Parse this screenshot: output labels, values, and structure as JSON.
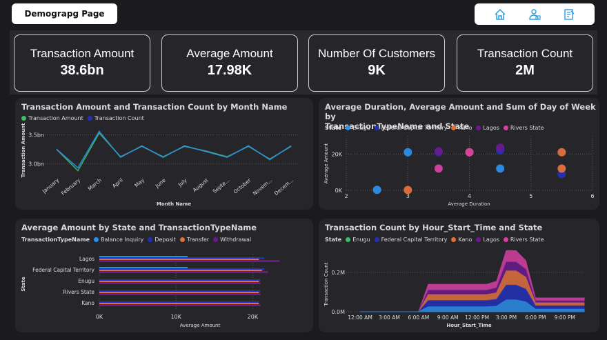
{
  "page_button": "Demograpg Page",
  "nav": {
    "icons": [
      "home-icon",
      "person-icon",
      "report-icon"
    ]
  },
  "kpis": [
    {
      "label": "Transaction Amount",
      "value": "38.6bn"
    },
    {
      "label": "Average Amount",
      "value": "17.98K"
    },
    {
      "label": "Number Of Customers",
      "value": "9K"
    },
    {
      "label": "Transaction Count",
      "value": "2M"
    }
  ],
  "colors": {
    "enugu": "#2d8ee9",
    "fct": "#2230b8",
    "kano": "#e0703e",
    "lagos": "#6b1a8e",
    "rivers": "#d640a3",
    "green": "#3cbf6a"
  },
  "chart1": {
    "title": "Transaction Amount and Transaction Count by Month Name",
    "legend": [
      "Transaction Amount",
      "Transaction Count"
    ],
    "xlabel": "Month Name",
    "ylabel": "Transaction Amount",
    "yticks": [
      "3.5bn",
      "3.0bn"
    ],
    "months": [
      "January",
      "February",
      "March",
      "April",
      "May",
      "June",
      "July",
      "August",
      "Septe...",
      "October",
      "Novem...",
      "Decem..."
    ]
  },
  "chart2": {
    "title_line1": "Average Duration, Average Amount and Sum of Day of Week by",
    "title_line2": "TransactionTypeName and State",
    "legend_title": "State",
    "legend": [
      "Enugu",
      "Federal Capital Territory",
      "Kano",
      "Lagos",
      "Rivers State"
    ],
    "xlabel": "Average Duration",
    "ylabel": "Average Amount",
    "xticks": [
      "2",
      "3",
      "4",
      "5",
      "6"
    ],
    "yticks": [
      "20K",
      "0K"
    ]
  },
  "chart3": {
    "title": "Average Amount by State and TransactionTypeName",
    "legend_title": "TransactionTypeName",
    "legend": [
      "Balance Inquiry",
      "Deposit",
      "Transfer",
      "Withdrawal"
    ],
    "ylabel": "State",
    "xlabel": "Average Amount",
    "states": [
      "Lagos",
      "Federal Capital Territory",
      "Enugu",
      "Rivers State",
      "Kano"
    ],
    "xticks": [
      "0K",
      "10K",
      "20K"
    ]
  },
  "chart4": {
    "title": "Transaction Count by Hour_Start_Time and State",
    "legend_title": "State",
    "legend": [
      "Enugu",
      "Federal Capital Territory",
      "Kano",
      "Lagos",
      "Rivers State"
    ],
    "xlabel": "Hour_Start_Time",
    "ylabel": "Transaction Count",
    "xticks": [
      "12:00 AM",
      "3:00 AM",
      "6:00 AM",
      "9:00 AM",
      "12:00 PM",
      "3:00 PM",
      "6:00 PM",
      "9:00 PM"
    ],
    "yticks": [
      "0.2M",
      "0.0M"
    ]
  },
  "chart_data": [
    {
      "type": "line",
      "title": "Transaction Amount and Transaction Count by Month Name",
      "categories": [
        "January",
        "February",
        "March",
        "April",
        "May",
        "June",
        "July",
        "August",
        "Septe...",
        "October",
        "Novem...",
        "Decem..."
      ],
      "series": [
        {
          "name": "Transaction Amount",
          "values": [
            3.25,
            2.88,
            3.53,
            3.12,
            3.3,
            3.12,
            3.3,
            3.22,
            3.12,
            3.3,
            3.08,
            3.3
          ]
        },
        {
          "name": "Transaction Count",
          "values": [
            3.25,
            2.93,
            3.56,
            3.11,
            3.31,
            3.11,
            3.31,
            3.21,
            3.11,
            3.31,
            3.07,
            3.31
          ]
        }
      ],
      "xlabel": "Month Name",
      "ylabel": "Transaction Amount",
      "ylim": [
        2.85,
        3.6
      ]
    },
    {
      "type": "scatter",
      "title": "Average Duration, Average Amount and Sum of Day of Week by TransactionTypeName and State",
      "xlabel": "Average Duration",
      "ylabel": "Average Amount",
      "xlim": [
        2,
        6
      ],
      "ylim": [
        0,
        30000
      ],
      "series": [
        {
          "name": "Enugu",
          "points": [
            [
              2.5,
              300
            ],
            [
              3.0,
              21000
            ],
            [
              4.5,
              12000
            ]
          ]
        },
        {
          "name": "Federal Capital Territory",
          "points": [
            [
              3.5,
              21000
            ],
            [
              4.5,
              22000
            ],
            [
              5.5,
              9000
            ]
          ]
        },
        {
          "name": "Kano",
          "points": [
            [
              3.0,
              200
            ],
            [
              4.0,
              21000
            ],
            [
              5.5,
              21000
            ],
            [
              5.5,
              12000
            ]
          ]
        },
        {
          "name": "Lagos",
          "points": [
            [
              3.5,
              21500
            ],
            [
              4.5,
              23500
            ]
          ]
        },
        {
          "name": "Rivers State",
          "points": [
            [
              3.5,
              12000
            ],
            [
              4.0,
              21000
            ]
          ]
        }
      ]
    },
    {
      "type": "bar",
      "title": "Average Amount by State and TransactionTypeName",
      "categories": [
        "Lagos",
        "Federal Capital Territory",
        "Enugu",
        "Rivers State",
        "Kano"
      ],
      "series": [
        {
          "name": "Balance Inquiry",
          "values": [
            11500,
            11500,
            0,
            0,
            0
          ]
        },
        {
          "name": "Deposit",
          "values": [
            21500,
            21500,
            21000,
            21000,
            20800
          ]
        },
        {
          "name": "Transfer",
          "values": [
            20800,
            21200,
            20800,
            20800,
            20800
          ]
        },
        {
          "name": "Withdrawal",
          "values": [
            23500,
            22000,
            21000,
            21000,
            21000
          ]
        }
      ],
      "xlabel": "Average Amount",
      "ylabel": "State",
      "xlim": [
        0,
        25000
      ]
    },
    {
      "type": "area",
      "title": "Transaction Count by Hour_Start_Time and State",
      "x": [
        0,
        3,
        6,
        7,
        8,
        9,
        10,
        11,
        12,
        13,
        14,
        15,
        16,
        17,
        18,
        19,
        20,
        21,
        22,
        23
      ],
      "series": [
        {
          "name": "Enugu",
          "values": [
            0,
            0,
            0,
            25000,
            25000,
            25000,
            25000,
            25000,
            25000,
            25000,
            28000,
            60000,
            60000,
            50000,
            13000,
            13000,
            13000,
            13000,
            13000,
            13000
          ]
        },
        {
          "name": "Federal Capital Territory",
          "values": [
            0,
            0,
            0,
            32000,
            32000,
            32000,
            32000,
            32000,
            32000,
            32000,
            35000,
            75000,
            75000,
            65000,
            17000,
            17000,
            17000,
            17000,
            17000,
            17000
          ]
        },
        {
          "name": "Kano",
          "values": [
            0,
            0,
            0,
            30000,
            30000,
            30000,
            30000,
            30000,
            30000,
            30000,
            33000,
            72000,
            72000,
            60000,
            15000,
            15000,
            15000,
            15000,
            15000,
            15000
          ]
        },
        {
          "name": "Lagos",
          "values": [
            0,
            0,
            0,
            22000,
            22000,
            22000,
            22000,
            22000,
            22000,
            22000,
            25000,
            45000,
            45000,
            40000,
            10000,
            10000,
            10000,
            10000,
            10000,
            10000
          ]
        },
        {
          "name": "Rivers State",
          "values": [
            0,
            0,
            0,
            30000,
            30000,
            30000,
            30000,
            30000,
            30000,
            30000,
            33000,
            58000,
            58000,
            45000,
            15000,
            15000,
            15000,
            15000,
            15000,
            15000
          ]
        }
      ],
      "xlabel": "Hour_Start_Time",
      "ylabel": "Transaction Count",
      "ylim": [
        0,
        280000
      ]
    }
  ]
}
